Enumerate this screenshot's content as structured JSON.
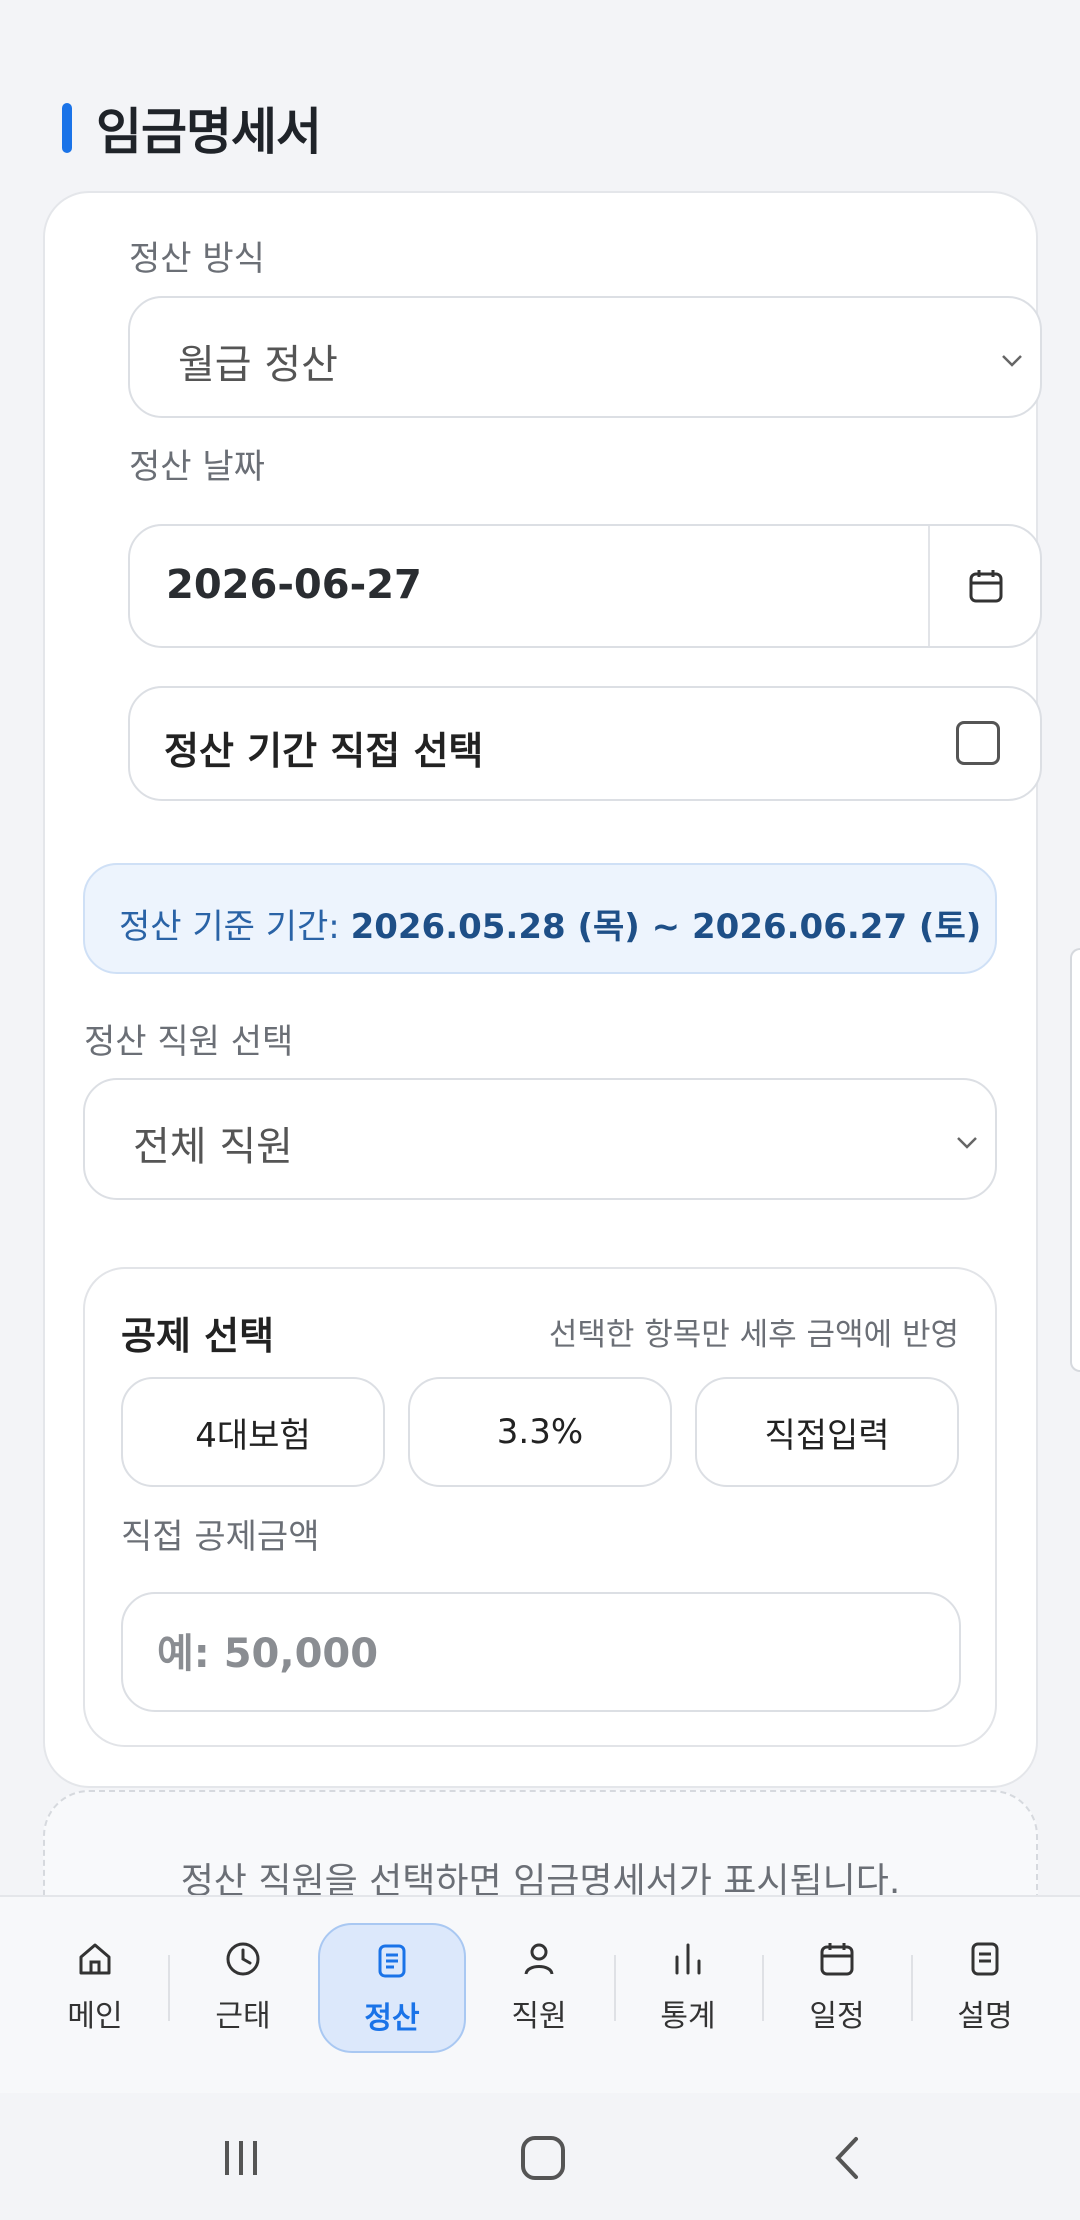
{
  "page": {
    "title": "임금명세서"
  },
  "settlement": {
    "method_label": "정산 방식",
    "method_value": "월급 정산",
    "date_label": "정산 날짜",
    "date_value": "2026-06-27",
    "custom_period_label": "정산 기간 직접 선택",
    "custom_period_checked": false,
    "period_prefix": "정산 기준 기간: ",
    "period_value": "2026.05.28 (목) ~ 2026.06.27 (토)",
    "employee_label": "정산 직원 선택",
    "employee_value": "전체 직원"
  },
  "deduction": {
    "title": "공제 선택",
    "hint": "선택한 항목만 세후 금액에 반영",
    "options": [
      "4대보험",
      "3.3%",
      "직접입력"
    ],
    "amount_label": "직접 공제금액",
    "amount_placeholder": "예: 50,000"
  },
  "empty_state": {
    "message": "정산 직원을 선택하면 임금명세서가 표시됩니다."
  },
  "nav": {
    "active": "정산",
    "items": [
      {
        "label": "메인",
        "icon": "home-icon"
      },
      {
        "label": "근태",
        "icon": "clock-icon"
      },
      {
        "label": "정산",
        "icon": "document-icon"
      },
      {
        "label": "직원",
        "icon": "person-icon"
      },
      {
        "label": "통계",
        "icon": "bar-chart-icon"
      },
      {
        "label": "일정",
        "icon": "calendar-icon"
      },
      {
        "label": "설명",
        "icon": "note-icon"
      }
    ]
  },
  "colors": {
    "accent": "#1a73e8",
    "info_bg": "#edf4fd",
    "info_text": "#1e4f87"
  }
}
